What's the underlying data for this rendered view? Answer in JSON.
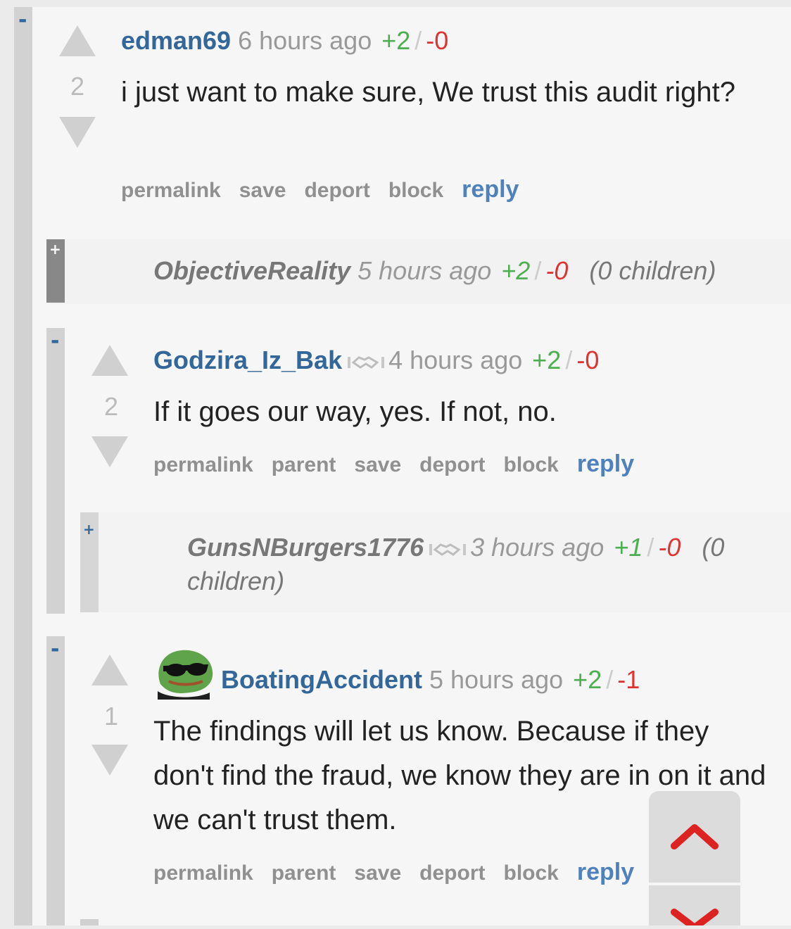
{
  "comments": [
    {
      "author": "edman69",
      "time": "6 hours ago",
      "upvotes": "+2",
      "slash": "/",
      "downvotes": "-0",
      "score": "2",
      "body": "i just want to make sure, We trust this audit right?",
      "actions": [
        "permalink",
        "save",
        "deport",
        "block",
        "reply"
      ]
    },
    {
      "author": "ObjectiveReality",
      "time": "5 hours ago",
      "upvotes": "+2",
      "slash": "/",
      "downvotes": "-0",
      "children": "(0 children)",
      "collapsed": true
    },
    {
      "author": "Godzira_Iz_Bak",
      "time": "4 hours ago",
      "upvotes": "+2",
      "slash": "/",
      "downvotes": "-0",
      "score": "2",
      "body": "If it goes our way, yes. If not, no.",
      "actions": [
        "permalink",
        "parent",
        "save",
        "deport",
        "block",
        "reply"
      ]
    },
    {
      "author": "GunsNBurgers1776",
      "time": "3 hours ago",
      "upvotes": "+1",
      "slash": "/",
      "downvotes": "-0",
      "children_line1": "(0",
      "children_line2": "children)",
      "collapsed": true
    },
    {
      "author": "BoatingAccident",
      "time": "5 hours ago",
      "upvotes": "+2",
      "slash": "/",
      "downvotes": "-1",
      "score": "1",
      "body": "The findings will let us know. Because if they don't find the fraud, we know they are in on it and we can't trust them.",
      "actions": [
        "permalink",
        "parent",
        "save",
        "deport",
        "block",
        "reply"
      ]
    }
  ],
  "toggles": {
    "minus": "-",
    "plus": "+"
  },
  "icons": {
    "upvote": "upvote-arrow-icon",
    "downvote": "downvote-arrow-icon",
    "badge": "handshake-badge-icon",
    "avatar": "frog-avatar-icon",
    "scroll_up": "chevron-up-icon",
    "scroll_down": "chevron-down-icon"
  },
  "colors": {
    "author": "#336699",
    "upvotes": "#4caf50",
    "downvotes": "#dd3333",
    "reply": "#4f81bd",
    "scroll_chevron": "#dd2222"
  }
}
